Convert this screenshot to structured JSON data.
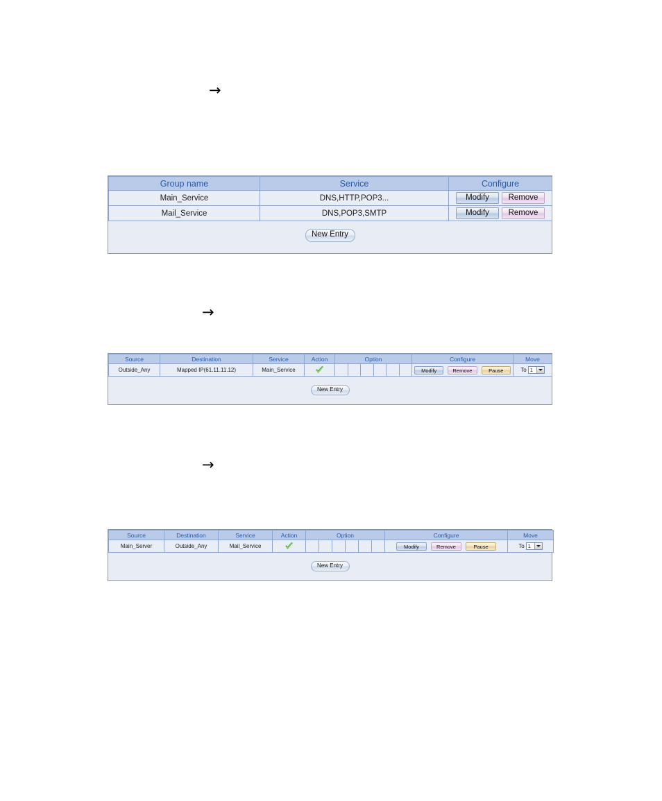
{
  "page": {
    "arrows": [
      {
        "glyph": "→",
        "name": "section-arrow-1"
      },
      {
        "glyph": "→",
        "name": "section-arrow-2"
      },
      {
        "glyph": "→",
        "name": "section-arrow-3"
      }
    ]
  },
  "colors": {
    "header_bg": "#b9cbe8",
    "header_text": "#2b5aa8",
    "cell_bg": "#e9edf6",
    "panel_bg": "#e8ecf5",
    "border": "#8ba5ce",
    "outer_border": "#7b96c6",
    "btn_modify": "#b9cbe6",
    "btn_remove": "#e3c8e6",
    "btn_pause": "#e6d19a",
    "check_green": "#55c22d"
  },
  "service_group_table": {
    "name": "service-group-table",
    "columns": [
      "Group name",
      "Service",
      "Configure"
    ],
    "rows": [
      {
        "group_name": "Main_Service",
        "service": "DNS,HTTP,POP3...",
        "buttons": [
          {
            "label": "Modify",
            "style": "modify"
          },
          {
            "label": "Remove",
            "style": "remove"
          }
        ]
      },
      {
        "group_name": "Mail_Service",
        "service": "DNS,POP3,SMTP",
        "buttons": [
          {
            "label": "Modify",
            "style": "modify"
          },
          {
            "label": "Remove",
            "style": "remove"
          }
        ]
      }
    ],
    "footer": {
      "new_entry_label": "New Entry"
    }
  },
  "policy_table_incoming": {
    "name": "policy-table-incoming",
    "columns": [
      "Source",
      "Destination",
      "Service",
      "Action",
      "Option",
      "Configure",
      "Move"
    ],
    "option_subcells": 6,
    "rows": [
      {
        "source": "Outside_Any",
        "destination": "Mapped IP(61.11.11.12)",
        "service": "Main_Service",
        "action_icon": "green-check-icon",
        "buttons": [
          {
            "label": "Modify",
            "style": "modify"
          },
          {
            "label": "Remove",
            "style": "remove"
          },
          {
            "label": "Pause",
            "style": "pause"
          }
        ],
        "move_to_label": "To",
        "move_value": "1"
      }
    ],
    "footer": {
      "new_entry_label": "New Entry"
    }
  },
  "policy_table_outgoing": {
    "name": "policy-table-outgoing",
    "columns": [
      "Source",
      "Destination",
      "Service",
      "Action",
      "Option",
      "Configure",
      "Move"
    ],
    "option_subcells": 6,
    "rows": [
      {
        "source": "Main_Server",
        "destination": "Outside_Any",
        "service": "Mail_Service",
        "action_icon": "green-check-icon",
        "buttons": [
          {
            "label": "Modify",
            "style": "modify"
          },
          {
            "label": "Remove",
            "style": "remove"
          },
          {
            "label": "Pause",
            "style": "pause"
          }
        ],
        "move_to_label": "To",
        "move_value": "1"
      }
    ],
    "footer": {
      "new_entry_label": "New Entry"
    }
  }
}
